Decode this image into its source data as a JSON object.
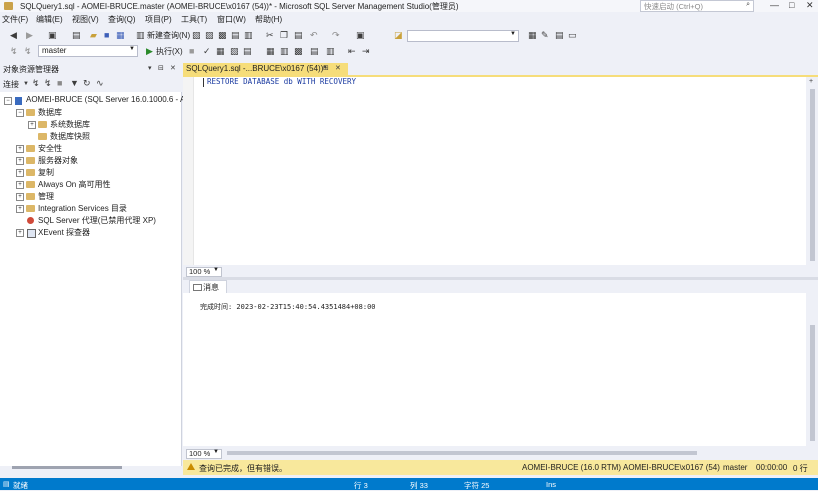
{
  "window": {
    "title": "SQLQuery1.sql - AOMEI-BRUCE.master (AOMEI-BRUCE\\x0167 (54))* - Microsoft SQL Server Management Studio(管理员)",
    "quick_launch_placeholder": "快速启动 (Ctrl+Q)",
    "controls": [
      "—",
      "□",
      "✕"
    ]
  },
  "menu": [
    "文件(F)",
    "编辑(E)",
    "视图(V)",
    "查询(Q)",
    "项目(P)",
    "工具(T)",
    "窗口(W)",
    "帮助(H)"
  ],
  "toolbar1": {
    "new_query_label": "新建查询(N)",
    "combo_value": ""
  },
  "toolbar2": {
    "database_value": "master",
    "execute_label": "执行(X)"
  },
  "object_explorer": {
    "title": "对象资源管理器",
    "header_icons": [
      "▾",
      "⊟",
      "✕"
    ],
    "connect_label": "连接",
    "tree": {
      "server": "AOMEI-BRUCE (SQL Server 16.0.1000.6 - AO",
      "databases": "数据库",
      "system_databases": "系统数据库",
      "db_snapshots": "数据库快照",
      "security": "安全性",
      "server_objects": "服务器对象",
      "replication": "复制",
      "always_on": "Always On 高可用性",
      "management": "管理",
      "integration_services": "Integration Services 目录",
      "sql_agent": "SQL Server 代理(已禁用代理 XP)",
      "xevent": "XEvent 探查器"
    }
  },
  "editor": {
    "tab_label": "SQLQuery1.sql -...BRUCE\\x0167 (54))*",
    "tab_icons": [
      "⊞",
      "✕"
    ],
    "query_text": "RESTORE DATABASE db WITH RECOVERY",
    "zoom": "100 %"
  },
  "results": {
    "tab_label": "消息",
    "message": "完成时间: 2023-02-23T15:40:54.4351484+08:00",
    "zoom": "100 %"
  },
  "query_status": {
    "message": "查询已完成，但有错误。",
    "server": "AOMEI-BRUCE (16.0 RTM)",
    "user": "AOMEI-BRUCE\\x0167 (54)",
    "database": "master",
    "elapsed": "00:00:00",
    "rows": "0 行"
  },
  "status_bar": {
    "ready": "就绪",
    "line": "行 3",
    "col": "列 33",
    "char": "字符 25",
    "mode": "Ins"
  },
  "colors": {
    "accent": "#007acc",
    "tab_active": "#f6dd7a",
    "query_status_bg": "#f8e89c"
  }
}
